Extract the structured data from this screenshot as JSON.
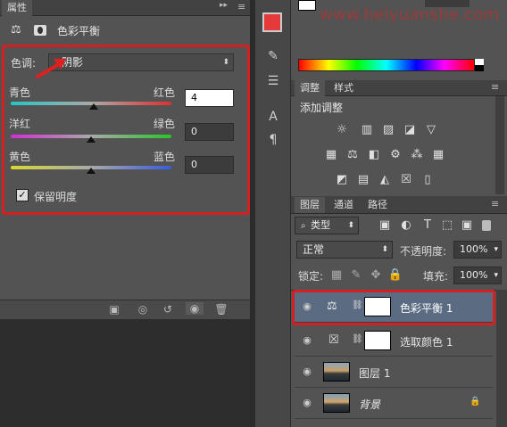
{
  "properties_panel": {
    "tab_label": "属性",
    "collapse_glyph": "▸▸",
    "menu_glyph": "≡",
    "title": "色彩平衡",
    "tone_label": "色调:",
    "tone_value": "阴影",
    "sliders": [
      {
        "left_label": "青色",
        "right_label": "红色",
        "value": "4",
        "position": 0.52
      },
      {
        "left_label": "洋红",
        "right_label": "绿色",
        "value": "0",
        "position": 0.5
      },
      {
        "left_label": "黄色",
        "right_label": "蓝色",
        "value": "0",
        "position": 0.5
      }
    ],
    "preserve_luminosity_label": "保留明度",
    "preserve_luminosity_checked": true
  },
  "watermark": "www.heiyuanshe.com",
  "adjustments_panel": {
    "tab_adjust": "调整",
    "tab_styles": "样式",
    "add_adjustment_label": "添加调整"
  },
  "layers_panel": {
    "tab_layers": "图层",
    "tab_channels": "通道",
    "tab_paths": "路径",
    "filter_kind": "类型",
    "blend_mode": "正常",
    "opacity_label": "不透明度:",
    "opacity_value": "100%",
    "lock_label": "锁定:",
    "fill_label": "填充:",
    "fill_value": "100%",
    "layers": [
      {
        "name": "色彩平衡 1",
        "type": "adjustment",
        "selected": true
      },
      {
        "name": "选取颜色 1",
        "type": "adjustment",
        "selected": false
      },
      {
        "name": "图层 1",
        "type": "image",
        "selected": false
      },
      {
        "name": "背景",
        "type": "background",
        "selected": false
      }
    ]
  },
  "colors": {
    "highlight_red": "#d32020",
    "selected_layer": "#5b6b82",
    "panel_bg": "#535353"
  }
}
